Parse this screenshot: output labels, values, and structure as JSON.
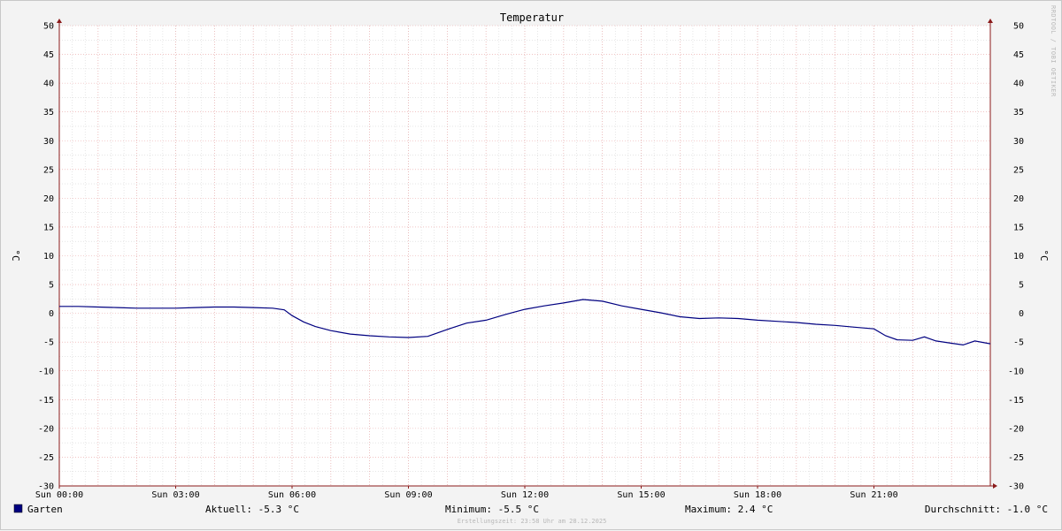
{
  "chart_data": {
    "type": "line",
    "title": "Temperatur",
    "ylabel": "°C",
    "ylabel_right": "°C",
    "ylim": [
      -30,
      50
    ],
    "y_ticks": [
      50,
      45,
      40,
      35,
      30,
      25,
      20,
      15,
      10,
      5,
      0,
      -5,
      -10,
      -15,
      -20,
      -25,
      -30
    ],
    "xlim_hours": [
      0,
      24
    ],
    "x_tick_labels": [
      "Sun 00:00",
      "Sun 03:00",
      "Sun 06:00",
      "Sun 09:00",
      "Sun 12:00",
      "Sun 15:00",
      "Sun 18:00",
      "Sun 21:00"
    ],
    "grid": true,
    "series": [
      {
        "name": "Garten",
        "color": "#000080",
        "x_hours": [
          0,
          0.5,
          1,
          1.5,
          2,
          2.5,
          3,
          3.5,
          4,
          4.5,
          5,
          5.5,
          5.8,
          6,
          6.3,
          6.6,
          7,
          7.5,
          8,
          8.5,
          9,
          9.5,
          10,
          10.5,
          11,
          11.5,
          12,
          12.5,
          13,
          13.5,
          14,
          14.5,
          15,
          15.5,
          16,
          16.5,
          17,
          17.5,
          18,
          18.5,
          19,
          19.5,
          20,
          20.5,
          21,
          21.3,
          21.6,
          22,
          22.3,
          22.6,
          23,
          23.3,
          23.6,
          24
        ],
        "values": [
          1.2,
          1.2,
          1.1,
          1.0,
          0.9,
          0.9,
          0.9,
          1.0,
          1.1,
          1.1,
          1.0,
          0.9,
          0.6,
          -0.4,
          -1.5,
          -2.3,
          -3.0,
          -3.6,
          -3.9,
          -4.1,
          -4.2,
          -4.0,
          -2.8,
          -1.7,
          -1.2,
          -0.2,
          0.7,
          1.3,
          1.8,
          2.4,
          2.1,
          1.3,
          0.7,
          0.1,
          -0.6,
          -0.9,
          -0.8,
          -0.9,
          -1.2,
          -1.4,
          -1.6,
          -1.9,
          -2.1,
          -2.4,
          -2.7,
          -3.9,
          -4.6,
          -4.7,
          -4.1,
          -4.8,
          -5.2,
          -5.5,
          -4.8,
          -5.3
        ]
      }
    ]
  },
  "legend": {
    "series_name": "Garten",
    "aktuell": "Aktuell: -5.3 °C",
    "minimum": "Minimum: -5.5 °C",
    "maximum": "Maximum: 2.4 °C",
    "durchschnitt": "Durchschnitt: -1.0 °C"
  },
  "watermark": "RRDTOOL / TOBI OETIKER",
  "footer": "Erstellungszeit: 23:58 Uhr am 28.12.2025",
  "colors": {
    "background": "#f3f3f3",
    "plot_background": "#ffffff",
    "major_grid": "#e8a0a0",
    "minor_grid": "#d6d6d6",
    "axis": "#8b1a1a",
    "series": "#000080"
  }
}
